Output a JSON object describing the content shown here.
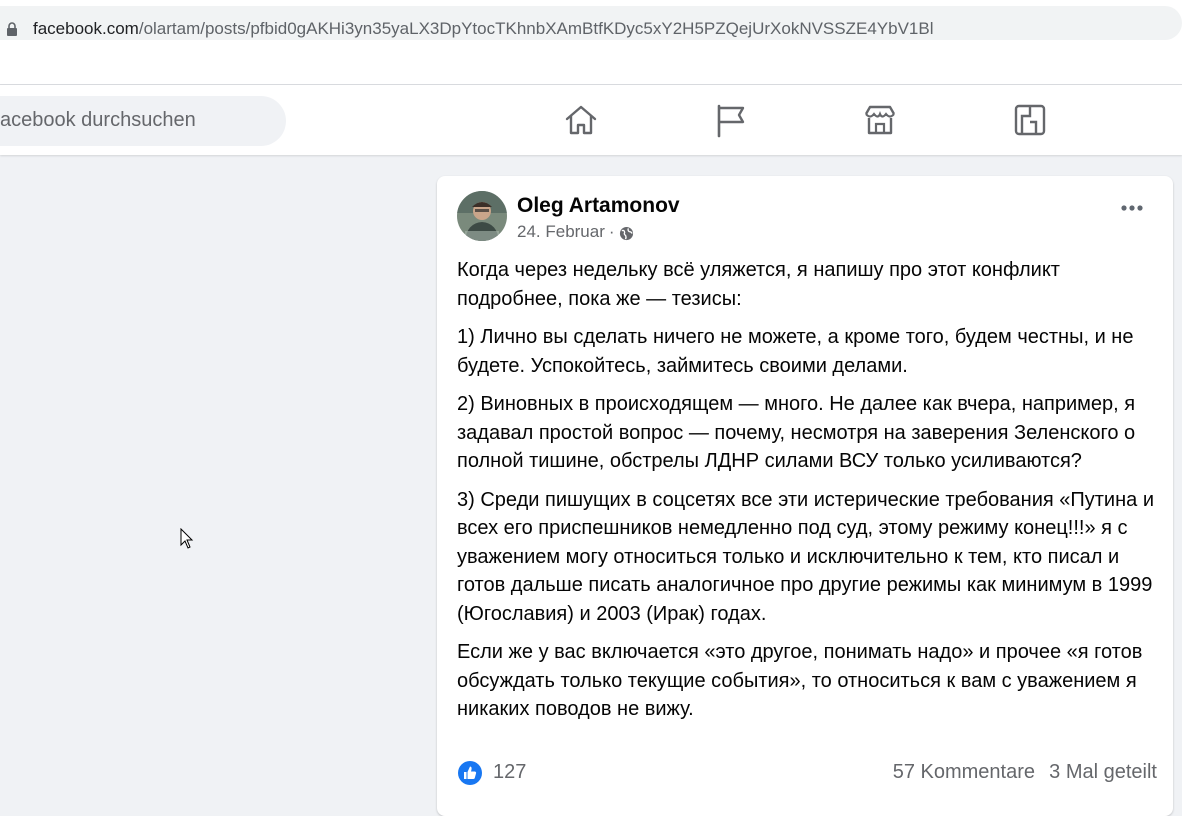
{
  "browser": {
    "url_host": "facebook.com",
    "url_path": "/olartam/posts/pfbid0gAKHi3yn35yaLX3DpYtocTKhnbXAmBtfKDyc5xY2H5PZQejUrXokNVSSZE4YbV1Bl"
  },
  "nav": {
    "search_placeholder": "acebook durchsuchen",
    "icons": [
      "home-icon",
      "pages-flag-icon",
      "marketplace-icon",
      "gaming-icon"
    ]
  },
  "post": {
    "author": "Oleg Artamonov",
    "date": "24. Februar",
    "separator": "·",
    "paragraphs": [
      "Когда через недельку всё уляжется, я напишу про этот конфликт подробнее, пока же — тезисы:",
      "1) Лично вы сделать ничего не можете, а кроме того, будем честны, и не будете. Успокойтесь, займитесь своими делами.",
      "2) Виновных в происходящем — много. Не далее как вчера, например, я задавал простой вопрос — почему, несмотря на заверения Зеленского о полной тишине, обстрелы ЛДНР силами ВСУ только усиливаются?",
      "3) Среди пишущих в соцсетях все эти истерические требования «Путина и всех его приспешников немедленно под суд, этому режиму конец!!!» я с уважением могу относиться только и исключительно к тем, кто писал и готов дальше писать аналогичное про другие режимы как минимум в 1999 (Югославия) и 2003 (Ирак) годах.",
      "Если же у вас включается «это другое, понимать надо» и прочее «я готов обсуждать только текущие события», то относиться к вам с уважением я никаких поводов не вижу."
    ],
    "likes": "127",
    "comments": "57 Kommentare",
    "shares": "3 Mal geteilt"
  },
  "colors": {
    "fb_blue": "#1877f2",
    "icon_gray": "#65676b",
    "page_bg": "#f0f2f5"
  }
}
